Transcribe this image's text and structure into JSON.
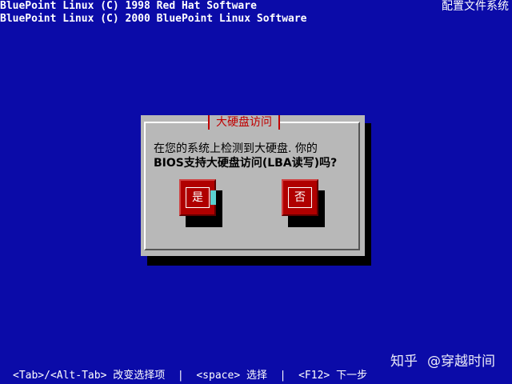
{
  "header": {
    "line1": "BluePoint Linux (C) 1998 Red Hat Software",
    "line2": "BluePoint Linux (C) 2000 BluePoint Linux Software",
    "top_right": "配置文件系统"
  },
  "dialog": {
    "title": "大硬盘访问",
    "message_line1": "在您的系统上检测到大硬盘. 你的",
    "message_line2": "BIOS支持大硬盘访问(LBA读写)吗?",
    "yes_label": "是",
    "no_label": "否"
  },
  "footer": {
    "help_text": "<Tab>/<Alt-Tab> 改变选择项  |  <space> 选择  |  <F12> 下一步"
  },
  "watermark": {
    "brand": "知乎",
    "handle": "@穿越时间"
  },
  "colors": {
    "background": "#0b0ba8",
    "dialog_bg": "#b8b8b8",
    "button_bg": "#b00000",
    "title_text": "#c00000",
    "cursor": "#5ad0d0"
  }
}
